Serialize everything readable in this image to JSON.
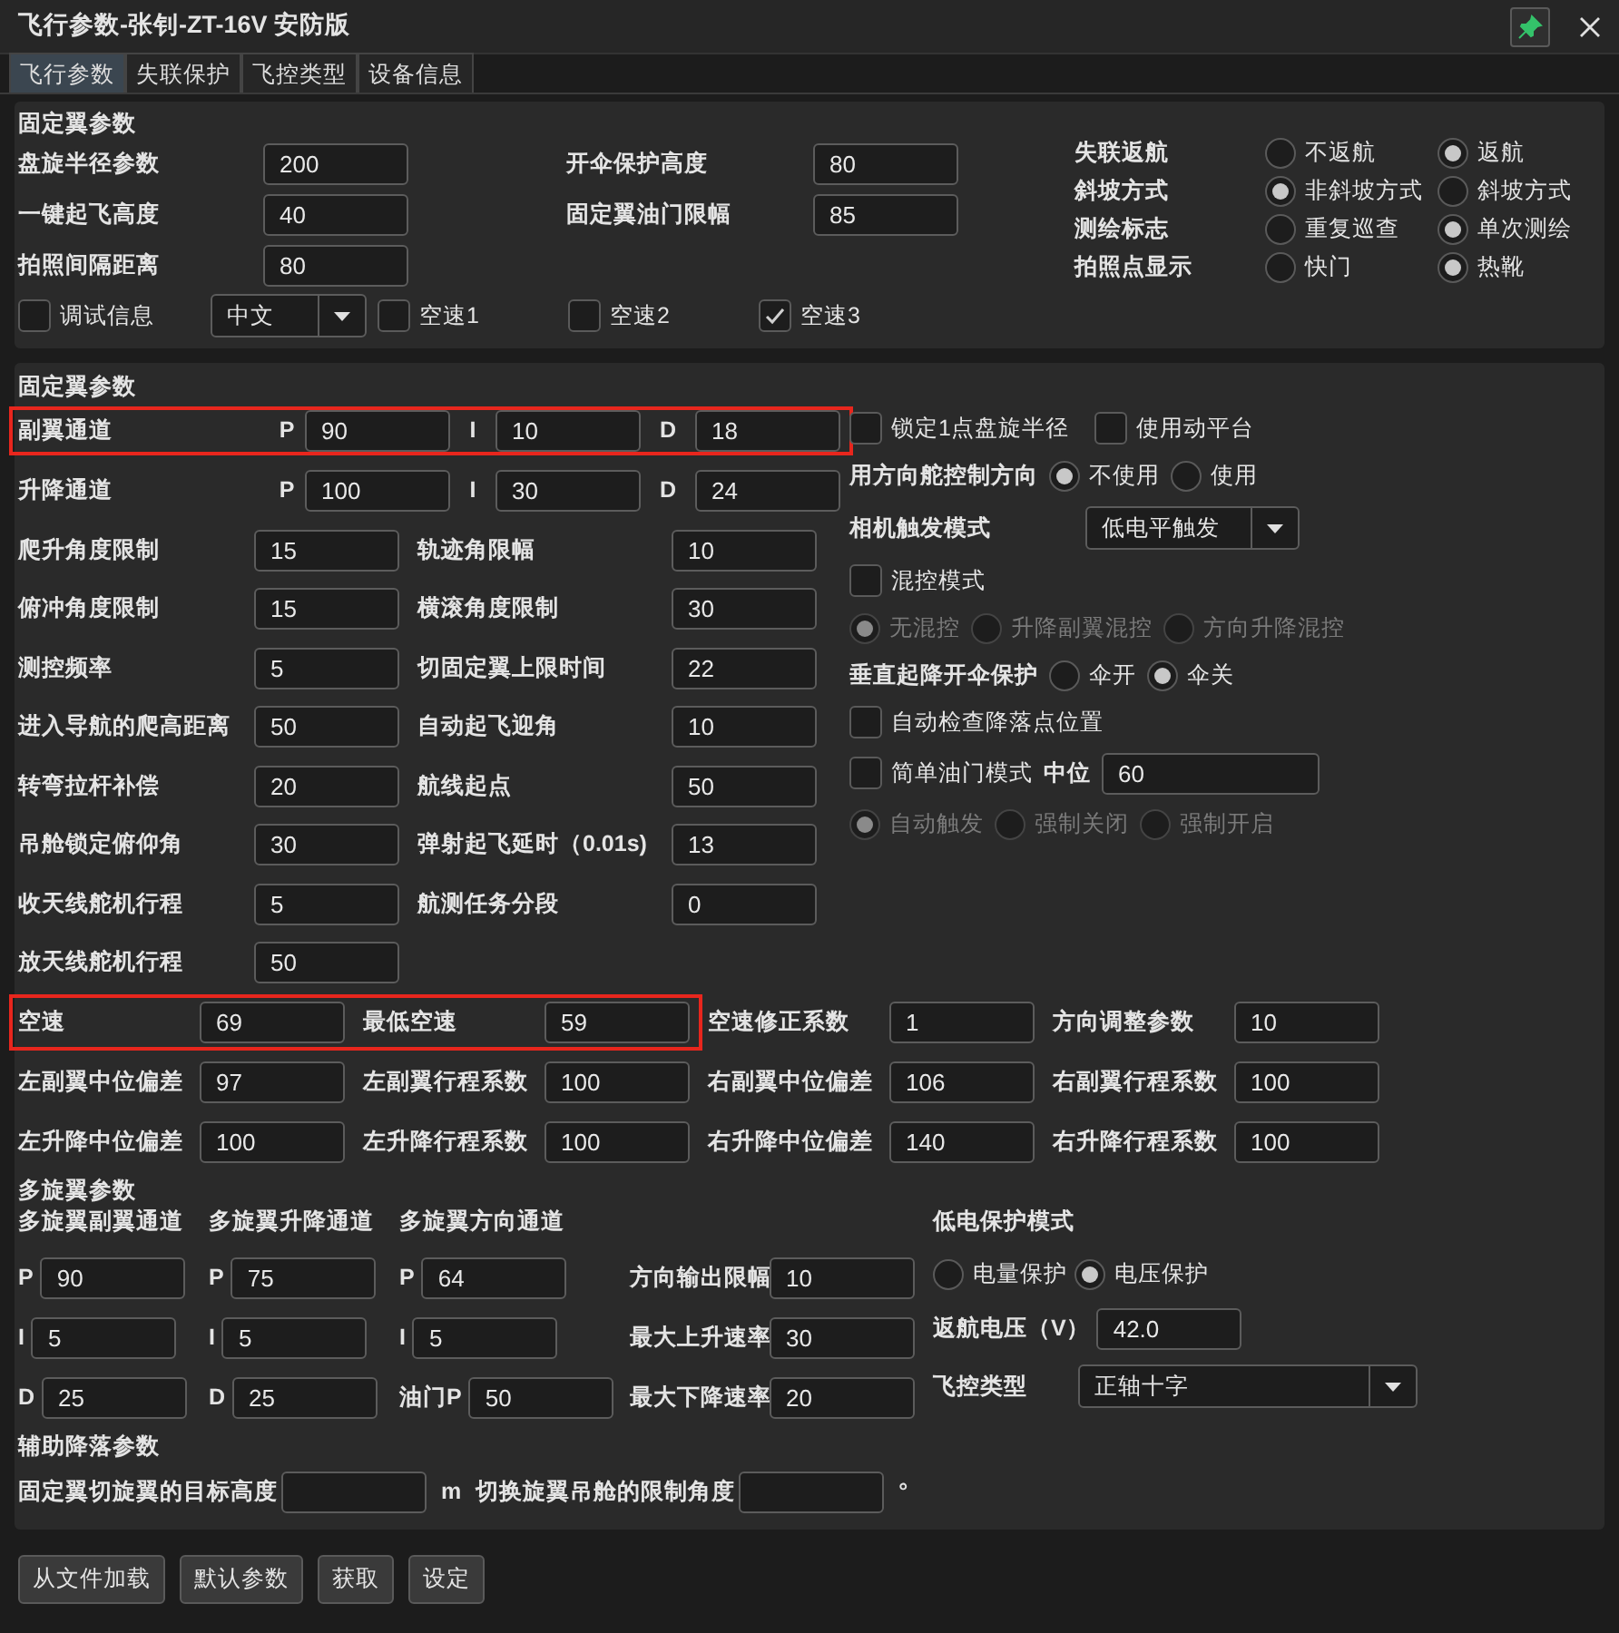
{
  "window": {
    "title": "飞行参数-张钊-ZT-16V 安防版"
  },
  "tabs": [
    {
      "label": "飞行参数",
      "selected": true
    },
    {
      "label": "失联保护",
      "selected": false
    },
    {
      "label": "飞控类型",
      "selected": false
    },
    {
      "label": "设备信息",
      "selected": false
    }
  ],
  "fixed_wing_basic": {
    "title": "固定翼参数",
    "fields": [
      {
        "label": "盘旋半径参数",
        "value": "200"
      },
      {
        "label": "开伞保护高度",
        "value": "80"
      },
      {
        "label": "一键起飞高度",
        "value": "40"
      },
      {
        "label": "固定翼油门限幅",
        "value": "85"
      },
      {
        "label": "拍照间隔距离",
        "value": "80"
      }
    ],
    "radio_groups": [
      {
        "label": "失联返航",
        "options": [
          {
            "label": "不返航",
            "selected": false
          },
          {
            "label": "返航",
            "selected": true
          }
        ]
      },
      {
        "label": "斜坡方式",
        "options": [
          {
            "label": "非斜坡方式",
            "selected": true
          },
          {
            "label": "斜坡方式",
            "selected": false
          }
        ]
      },
      {
        "label": "测绘标志",
        "options": [
          {
            "label": "重复巡查",
            "selected": false
          },
          {
            "label": "单次测绘",
            "selected": true
          }
        ]
      },
      {
        "label": "拍照点显示",
        "options": [
          {
            "label": "快门",
            "selected": false
          },
          {
            "label": "热靴",
            "selected": true
          }
        ]
      }
    ],
    "options_row": [
      {
        "kind": "checkbox",
        "label": "调试信息",
        "checked": false
      },
      {
        "kind": "combo",
        "value": "中文"
      },
      {
        "kind": "checkbox",
        "label": "空速1",
        "checked": false
      },
      {
        "kind": "checkbox",
        "label": "空速2",
        "checked": false
      },
      {
        "kind": "checkbox",
        "label": "空速3",
        "checked": true
      }
    ]
  },
  "fixed_wing": {
    "title": "固定翼参数",
    "pid_rows": [
      {
        "label": "副翼通道",
        "highlighted": true,
        "terms": [
          {
            "label": "P",
            "value": "90"
          },
          {
            "label": "I",
            "value": "10"
          },
          {
            "label": "D",
            "value": "18"
          }
        ]
      },
      {
        "label": "升降通道",
        "highlighted": false,
        "terms": [
          {
            "label": "P",
            "value": "100"
          },
          {
            "label": "I",
            "value": "30"
          },
          {
            "label": "D",
            "value": "24"
          }
        ]
      }
    ],
    "fields": [
      {
        "label": "爬升角度限制",
        "value": "15"
      },
      {
        "label": "轨迹角限幅",
        "value": "10"
      },
      {
        "label": "俯冲角度限制",
        "value": "15"
      },
      {
        "label": "横滚角度限制",
        "value": "30"
      },
      {
        "label": "测控频率",
        "value": "5"
      },
      {
        "label": "切固定翼上限时间",
        "value": "22"
      },
      {
        "label": "进入导航的爬高距离",
        "value": "50"
      },
      {
        "label": "自动起飞迎角",
        "value": "10"
      },
      {
        "label": "转弯拉杆补偿",
        "value": "20"
      },
      {
        "label": "航线起点",
        "value": "50"
      },
      {
        "label": "吊舱锁定俯仰角",
        "value": "30"
      },
      {
        "label": "弹射起飞延时（0.01s)",
        "value": "13"
      },
      {
        "label": "收天线舵机行程",
        "value": "5"
      },
      {
        "label": "航测任务分段",
        "value": "0"
      },
      {
        "label": "放天线舵机行程",
        "value": "50"
      }
    ],
    "options": [
      {
        "kind": "checkboxes",
        "items": [
          {
            "label": "锁定1点盘旋半径",
            "checked": false
          },
          {
            "label": "使用动平台",
            "checked": false
          }
        ]
      },
      {
        "kind": "radio",
        "label": "用方向舵控制方向",
        "disabled": false,
        "options": [
          {
            "label": "不使用",
            "selected": true
          },
          {
            "label": "使用",
            "selected": false
          }
        ]
      },
      {
        "kind": "combo",
        "label": "相机触发模式",
        "value": "低电平触发"
      },
      {
        "kind": "checkboxes",
        "items": [
          {
            "label": "混控模式",
            "checked": false
          }
        ]
      },
      {
        "kind": "radio",
        "disabled": true,
        "options": [
          {
            "label": "无混控",
            "selected": true
          },
          {
            "label": "升降副翼混控",
            "selected": false
          },
          {
            "label": "方向升降混控",
            "selected": false
          }
        ]
      },
      {
        "kind": "radio",
        "label": "垂直起降开伞保护",
        "disabled": false,
        "options": [
          {
            "label": "伞开",
            "selected": false
          },
          {
            "label": "伞关",
            "selected": true
          }
        ]
      },
      {
        "kind": "checkboxes",
        "items": [
          {
            "label": "自动检查降落点位置",
            "checked": false
          }
        ]
      },
      {
        "kind": "checkbox_field",
        "label": "简单油门模式",
        "checked": false,
        "field_label": "中位",
        "value": "60"
      },
      {
        "kind": "radio",
        "disabled": true,
        "options": [
          {
            "label": "自动触发",
            "selected": true
          },
          {
            "label": "强制关闭",
            "selected": false
          },
          {
            "label": "强制开启",
            "selected": false
          }
        ]
      }
    ],
    "trim_rows": [
      [
        {
          "label": "空速",
          "value": "69",
          "highlighted": true
        },
        {
          "label": "最低空速",
          "value": "59",
          "highlighted": true
        },
        {
          "label": "空速修正系数",
          "value": "1",
          "highlighted": false
        },
        {
          "label": "方向调整参数",
          "value": "10",
          "highlighted": false
        }
      ],
      [
        {
          "label": "左副翼中位偏差",
          "value": "97",
          "highlighted": false
        },
        {
          "label": "左副翼行程系数",
          "value": "100",
          "highlighted": false
        },
        {
          "label": "右副翼中位偏差",
          "value": "106",
          "highlighted": false
        },
        {
          "label": "右副翼行程系数",
          "value": "100",
          "highlighted": false
        }
      ],
      [
        {
          "label": "左升降中位偏差",
          "value": "100",
          "highlighted": false
        },
        {
          "label": "左升降行程系数",
          "value": "100",
          "highlighted": false
        },
        {
          "label": "右升降中位偏差",
          "value": "140",
          "highlighted": false
        },
        {
          "label": "右升降行程系数",
          "value": "100",
          "highlighted": false
        }
      ]
    ]
  },
  "multirotor": {
    "title": "多旋翼参数",
    "channels": [
      {
        "title": "多旋翼副翼通道",
        "fields": [
          {
            "label": "P",
            "value": "90"
          },
          {
            "label": "I",
            "value": "5"
          },
          {
            "label": "D",
            "value": "25"
          }
        ]
      },
      {
        "title": "多旋翼升降通道",
        "fields": [
          {
            "label": "P",
            "value": "75"
          },
          {
            "label": "I",
            "value": "5"
          },
          {
            "label": "D",
            "value": "25"
          }
        ]
      },
      {
        "title": "多旋翼方向通道",
        "fields": [
          {
            "label": "P",
            "value": "64"
          },
          {
            "label": "I",
            "value": "5"
          },
          {
            "label": "油门P",
            "value": "50"
          }
        ]
      }
    ],
    "limits": [
      {
        "label": "方向输出限幅",
        "value": "10"
      },
      {
        "label": "最大上升速率",
        "value": "30"
      },
      {
        "label": "最大下降速率",
        "value": "20"
      }
    ],
    "low_battery": {
      "title": "低电保护模式",
      "options": [
        {
          "label": "电量保护",
          "selected": false
        },
        {
          "label": "电压保护",
          "selected": true
        }
      ],
      "voltage": {
        "label": "返航电压（V）",
        "value": "42.0"
      },
      "controller_type": {
        "label": "飞控类型",
        "value": "正轴十字"
      }
    }
  },
  "landing_aid": {
    "title": "辅助降落参数",
    "fields": [
      {
        "label": "固定翼切旋翼的目标高度",
        "unit": "m"
      },
      {
        "label": "切换旋翼吊舱的限制角度",
        "unit": "°"
      }
    ]
  },
  "buttons": [
    "从文件加载",
    "默认参数",
    "获取",
    "设定"
  ]
}
